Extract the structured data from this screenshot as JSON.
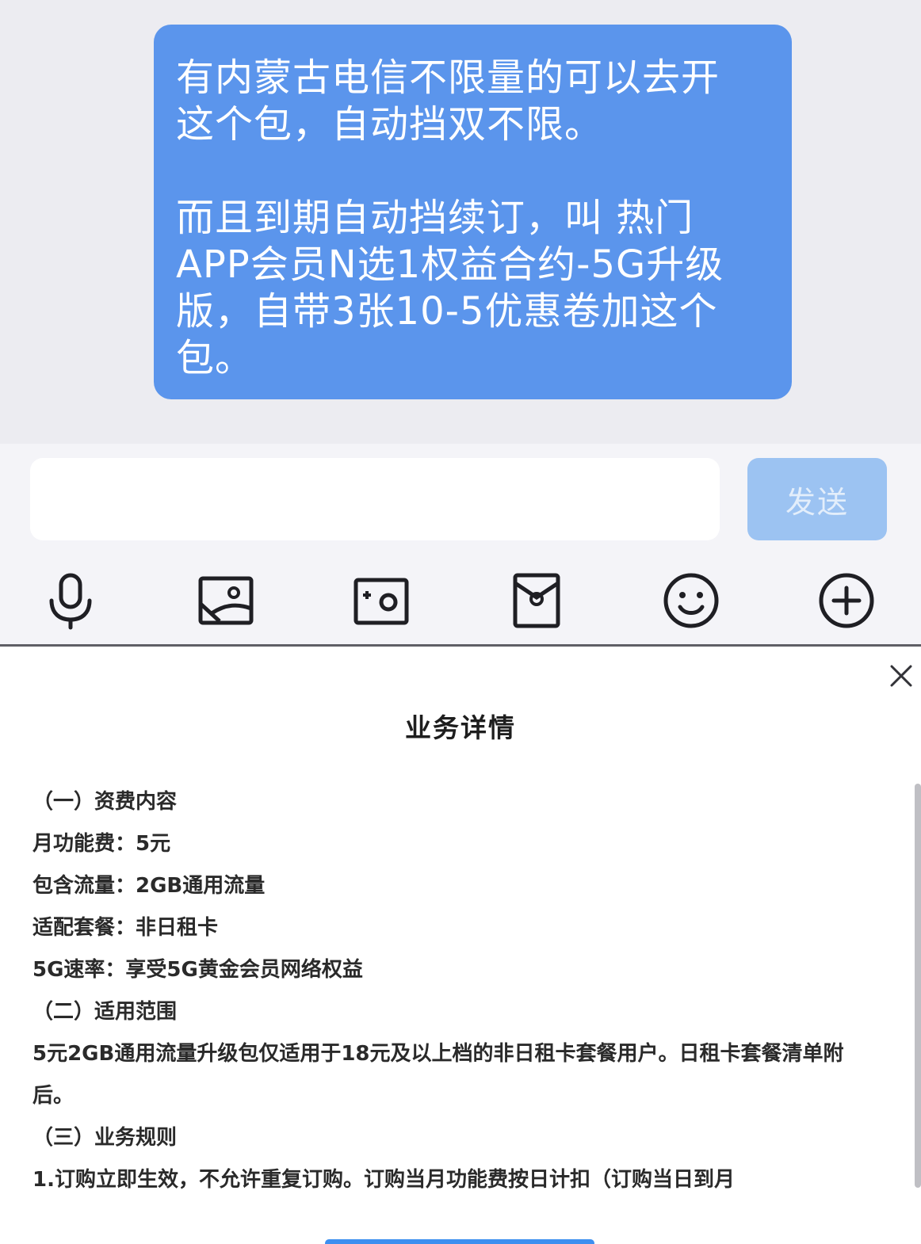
{
  "chat": {
    "message": {
      "paragraph1": "有内蒙古电信不限量的可以去开\n这个包，自动挡双不限。",
      "paragraph2": "而且到期自动挡续订，叫 热门\nAPP会员N选1权益合约-5G升级\n版，自带3张10-5优惠卷加这个\n包。"
    }
  },
  "composer": {
    "input_value": "",
    "input_placeholder": "",
    "send_label": "发送",
    "tools": [
      "microphone-icon",
      "image-icon",
      "camera-icon",
      "red-envelope-icon",
      "emoji-icon",
      "plus-icon"
    ]
  },
  "details": {
    "title": "业务详情",
    "lines": [
      "（一）资费内容",
      "月功能费：5元",
      "包含流量：2GB通用流量",
      "适配套餐：非日租卡",
      "5G速率：享受5G黄金会员网络权益",
      "（二）适用范围",
      "5元2GB通用流量升级包仅适用于18元及以上档的非日租卡套餐用户。日租卡套餐清单附后。",
      "（三）业务规则",
      "1.订购立即生效，不允许重复订购。订购当月功能费按日计扣（订购当日到月"
    ]
  },
  "colors": {
    "bubble": "#5b95ec",
    "send_button": "#9cc3f2",
    "accent": "#3d8ff0"
  }
}
